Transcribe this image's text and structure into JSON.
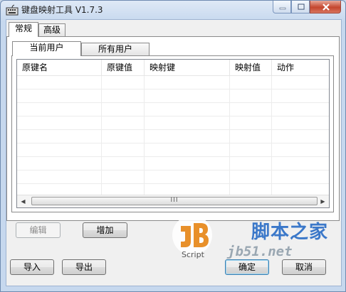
{
  "window": {
    "title": "键盘映射工具 V1.7.3"
  },
  "top_tabs": [
    {
      "label": "常规",
      "selected": true
    },
    {
      "label": "高级",
      "selected": false
    }
  ],
  "user_tabs": [
    {
      "label": "当前用户",
      "selected": true
    },
    {
      "label": "所有用户",
      "selected": false
    }
  ],
  "table": {
    "columns": [
      "原键名",
      "原键值",
      "映射键",
      "映射值",
      "动作"
    ],
    "rows": []
  },
  "scrollbar": {
    "thumb_grip": "III"
  },
  "buttons": {
    "edit": "编辑",
    "add": "增加",
    "import": "导入",
    "export": "导出",
    "ok": "确定",
    "cancel": "取消"
  },
  "watermark": {
    "site_name": "脚本之家",
    "url": "jb51.net",
    "logo_text": "Script"
  },
  "colors": {
    "window_frame": "#c6d8ee",
    "close_button": "#c4462e",
    "watermark_blue": "#3b78c9"
  }
}
